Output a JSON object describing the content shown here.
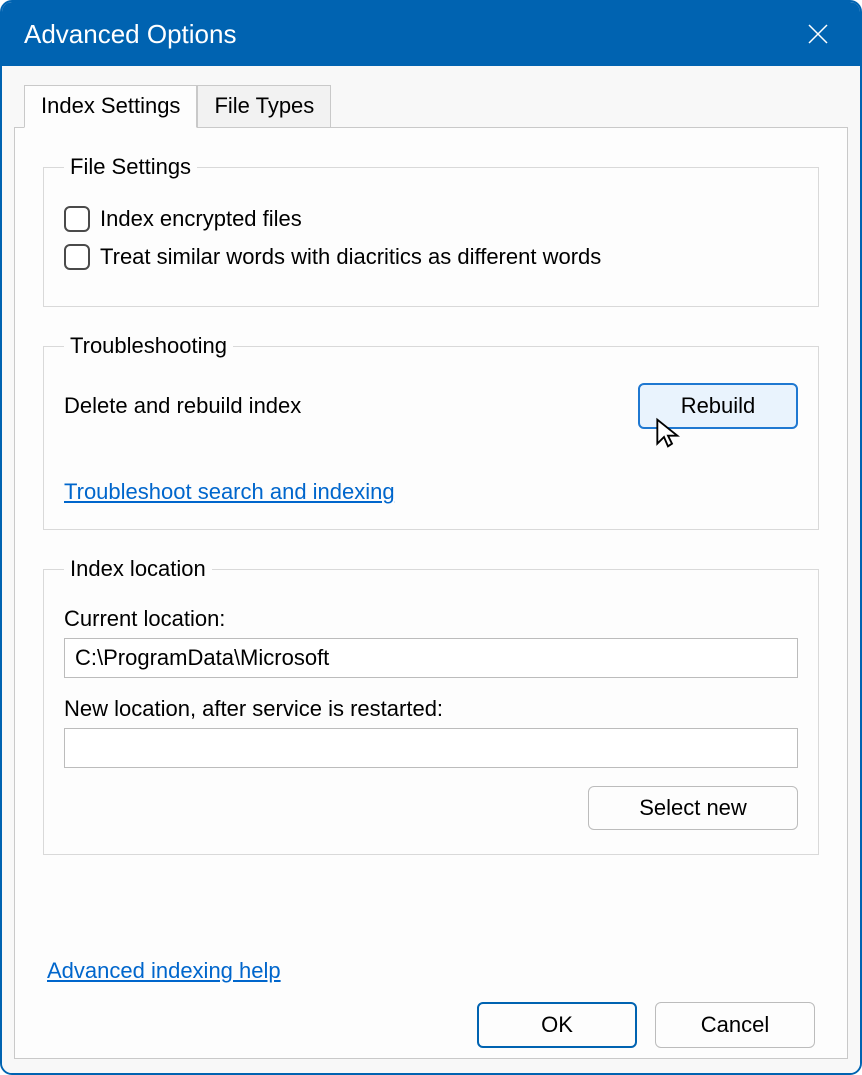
{
  "window": {
    "title": "Advanced Options"
  },
  "tabs": {
    "index_settings": "Index Settings",
    "file_types": "File Types"
  },
  "file_settings": {
    "legend": "File Settings",
    "encrypted": "Index encrypted files",
    "diacritics": "Treat similar words with diacritics as different words"
  },
  "troubleshooting": {
    "legend": "Troubleshooting",
    "delete_rebuild": "Delete and rebuild index",
    "rebuild_btn": "Rebuild",
    "link": "Troubleshoot search and indexing"
  },
  "index_location": {
    "legend": "Index location",
    "current_label": "Current location:",
    "current_value": "C:\\ProgramData\\Microsoft",
    "new_label": "New location, after service is restarted:",
    "new_value": "",
    "select_new": "Select new"
  },
  "links": {
    "advanced_help": "Advanced indexing help"
  },
  "buttons": {
    "ok": "OK",
    "cancel": "Cancel"
  }
}
